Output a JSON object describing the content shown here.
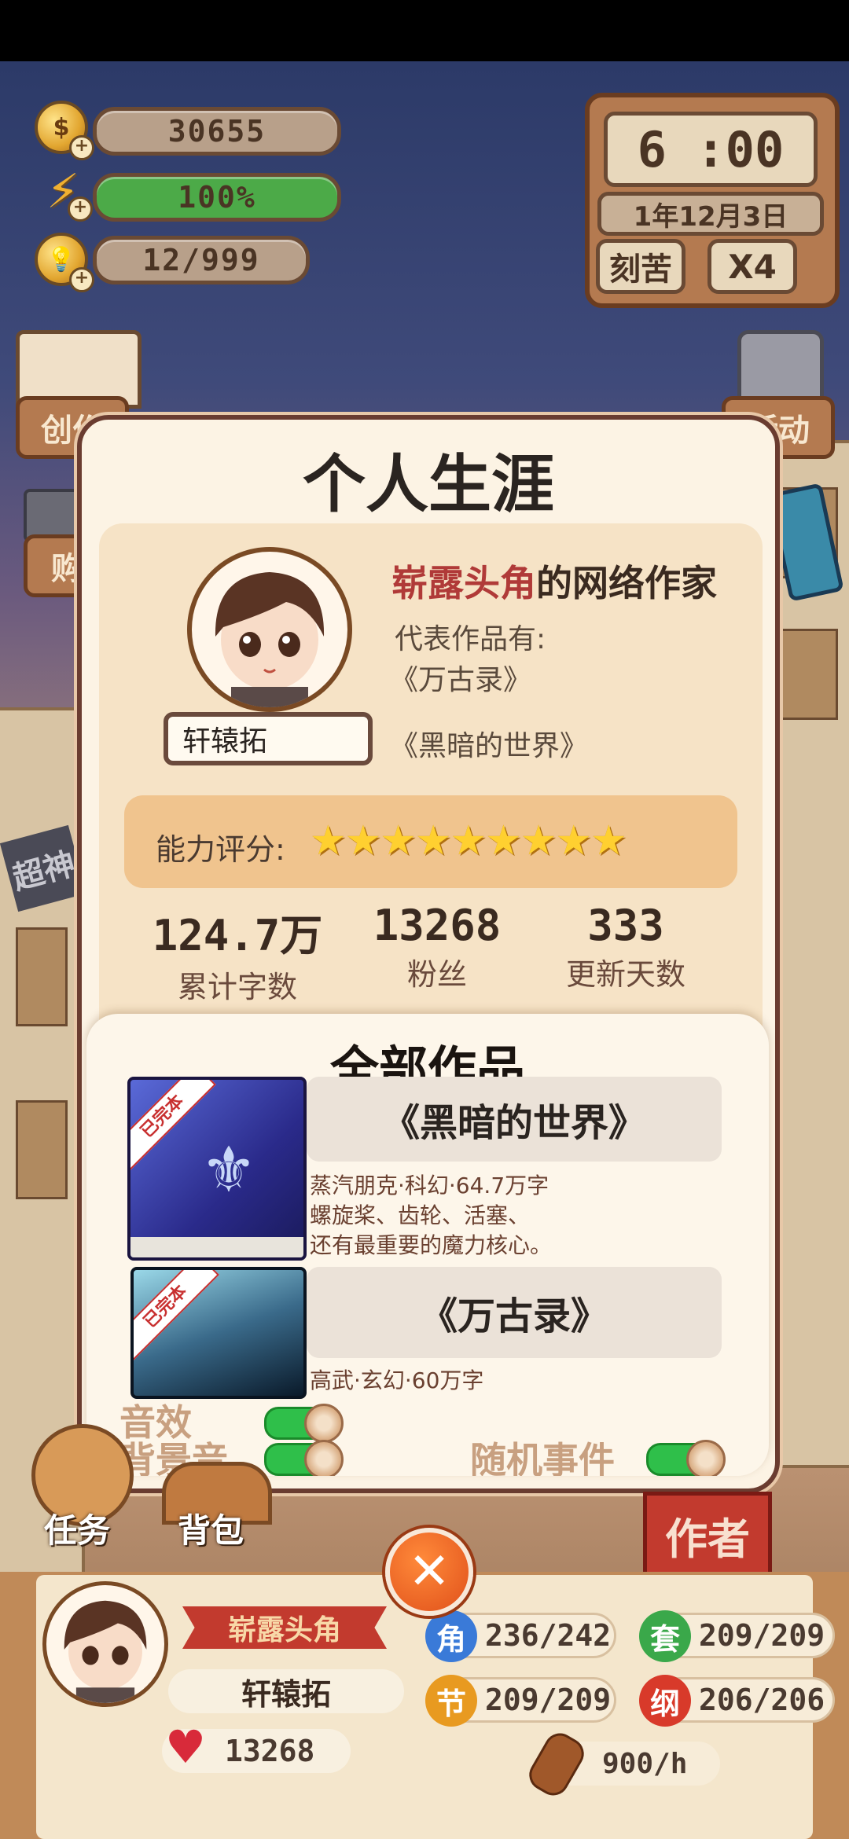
{
  "hud": {
    "coins": "30655",
    "energy": "100%",
    "inspiration": "12/999",
    "energy_progress": 1.0
  },
  "clock": {
    "time": "6 :00",
    "date": "1年12月3日",
    "mode_label": "刻苦",
    "speed_label": "X4"
  },
  "side_buttons": {
    "left_top": "创作",
    "left_mid": "购",
    "right_top": "活动",
    "building_sign": "超神"
  },
  "modal": {
    "title": "个人生涯",
    "profile": {
      "rank_highlight": "崭露头角",
      "rank_suffix": "的网络作家",
      "works_intro": "代表作品有:",
      "rep_work_1": "《万古录》",
      "rep_work_2": "《黑暗的世界》",
      "author_name": "轩辕拓",
      "rating_label": "能力评分:",
      "rating_stars": 9
    },
    "stats": [
      {
        "value": "124.7万",
        "label": "累计字数"
      },
      {
        "value": "13268",
        "label": "粉丝"
      },
      {
        "value": "333",
        "label": "更新天数"
      }
    ],
    "works_header": "全部作品",
    "works": [
      {
        "title": "《黑暗的世界》",
        "badge": "已完本",
        "meta": "蒸汽朋克·科幻·64.7万字",
        "desc_line1": "螺旋桨、齿轮、活塞、",
        "desc_line2": "还有最重要的魔力核心。"
      },
      {
        "title": "《万古录》",
        "badge": "已完本",
        "meta": "高武·玄幻·60万字"
      }
    ],
    "settings": {
      "sound_label": "音效",
      "bgm_label": "背景音",
      "random_event_label": "随机事件",
      "sound_on": true,
      "bgm_on": true,
      "random_event_on": true
    }
  },
  "bottom_nav": {
    "tasks": "任务",
    "bag": "背包",
    "author": "作者"
  },
  "author_panel": {
    "rank": "崭露头角",
    "name": "轩辕拓",
    "fans": "13268",
    "resources": [
      {
        "icon_char": "角",
        "value": "236/242",
        "color": "#3a7ad8"
      },
      {
        "icon_char": "套",
        "value": "209/209",
        "color": "#3aa84a"
      },
      {
        "icon_char": "节",
        "value": "209/209",
        "color": "#e89a20"
      },
      {
        "icon_char": "纲",
        "value": "206/206",
        "color": "#d83a2a"
      }
    ],
    "rate": "900/h"
  }
}
